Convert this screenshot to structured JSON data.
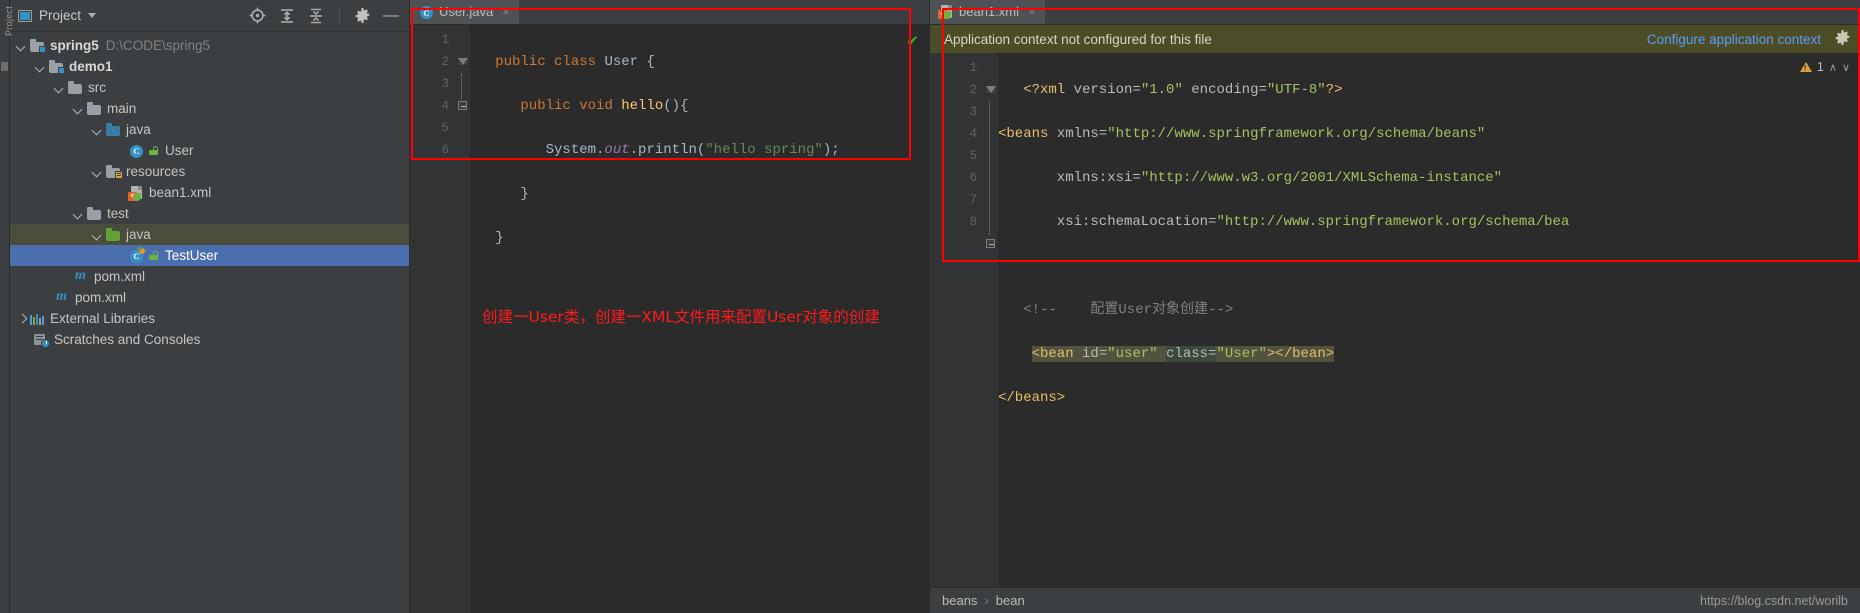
{
  "window": {
    "tool_window_label": "Project"
  },
  "sidebar": {
    "title": "Project",
    "tools": [
      {
        "name": "locate-icon",
        "tooltip": "Select Opened File"
      },
      {
        "name": "expand-all-icon",
        "tooltip": "Expand All"
      },
      {
        "name": "collapse-all-icon",
        "tooltip": "Collapse All"
      },
      {
        "name": "gear-icon",
        "tooltip": "Settings"
      },
      {
        "name": "minimize-icon",
        "tooltip": "Hide"
      }
    ],
    "tree": [
      {
        "label": "spring5",
        "path": "D:\\CODE\\spring5",
        "indent": 0,
        "arrow": "open",
        "icon": "module-folder",
        "bold": true,
        "state": "none"
      },
      {
        "label": "demo1",
        "path": "",
        "indent": 1,
        "arrow": "open",
        "icon": "module-folder",
        "bold": true,
        "state": "none"
      },
      {
        "label": "src",
        "path": "",
        "indent": 2,
        "arrow": "open",
        "icon": "folder-gray",
        "bold": false,
        "state": "none"
      },
      {
        "label": "main",
        "path": "",
        "indent": 3,
        "arrow": "open",
        "icon": "folder-gray",
        "bold": false,
        "state": "none"
      },
      {
        "label": "java",
        "path": "",
        "indent": 4,
        "arrow": "open",
        "icon": "folder-blue",
        "bold": false,
        "state": "none"
      },
      {
        "label": "User",
        "path": "",
        "indent": 5,
        "arrow": "none",
        "icon": "java-class",
        "bold": false,
        "state": "none"
      },
      {
        "label": "resources",
        "path": "",
        "indent": 4,
        "arrow": "open",
        "icon": "folder-resources",
        "bold": false,
        "state": "none"
      },
      {
        "label": "bean1.xml",
        "path": "",
        "indent": 5,
        "arrow": "none",
        "icon": "spring-xml",
        "bold": false,
        "state": "none"
      },
      {
        "label": "test",
        "path": "",
        "indent": 3,
        "arrow": "open",
        "icon": "folder-gray",
        "bold": false,
        "state": "none"
      },
      {
        "label": "java",
        "path": "",
        "indent": 4,
        "arrow": "open",
        "icon": "folder-green",
        "bold": false,
        "state": "hover"
      },
      {
        "label": "TestUser",
        "path": "",
        "indent": 5,
        "arrow": "none",
        "icon": "test-class",
        "bold": false,
        "state": "selected"
      },
      {
        "label": "pom.xml",
        "path": "",
        "indent": 3,
        "arrow": "none",
        "icon": "maven",
        "bold": false,
        "state": "none"
      },
      {
        "label": "pom.xml",
        "path": "",
        "indent": 2,
        "arrow": "none",
        "icon": "maven",
        "bold": false,
        "state": "none"
      },
      {
        "label": "External Libraries",
        "path": "",
        "indent": 1,
        "arrow": "closed",
        "icon": "libraries",
        "bold": false,
        "state": "none"
      },
      {
        "label": "Scratches and Consoles",
        "path": "",
        "indent": 1,
        "arrow": "none",
        "icon": "scratches",
        "bold": false,
        "state": "none"
      }
    ]
  },
  "java_editor": {
    "tab": {
      "label": "User.java",
      "icon": "java-class-icon",
      "close": "×"
    },
    "inspection_status": "✔",
    "line_numbers": [
      "1",
      "2",
      "3",
      "4",
      "5",
      "6"
    ],
    "code": {
      "l1_kw_public": "public",
      "l1_kw_class": "class",
      "l1_name": "User",
      "l1_brace": "{",
      "l2_kw_public": "public",
      "l2_kw_void": "void",
      "l2_name": "hello",
      "l2_rest": "(){",
      "l3_system": "System.",
      "l3_out": "out",
      "l3_println": ".println(",
      "l3_string": "\"hello spring\"",
      "l3_end": ");",
      "l4_brace": "}",
      "l5_brace": "}"
    }
  },
  "xml_editor": {
    "tab": {
      "label": "bean1.xml",
      "icon": "spring-xml-icon",
      "close": "×"
    },
    "banner": {
      "message": "Application context not configured for this file",
      "action": "Configure application context",
      "gear": "gear-icon"
    },
    "warnings": {
      "count": "1",
      "icon": "warning-triangle-icon",
      "up": "∧",
      "down": "∨"
    },
    "line_numbers": [
      "1",
      "2",
      "3",
      "4",
      "5",
      "6",
      "7",
      "8"
    ],
    "code": {
      "l1": "<?xml version=\"1.0\" encoding=\"UTF-8\"?>",
      "l1_tag": "<?xml",
      "l1_att_version": "version=",
      "l1_val_version": "\"1.0\"",
      "l1_att_encoding": "encoding=",
      "l1_val_encoding": "\"UTF-8\"",
      "l1_close": "?>",
      "l2_tag": "<beans",
      "l2_att": "xmlns=",
      "l2_val": "\"http://www.springframework.org/schema/beans\"",
      "l3_att": "xmlns:xsi=",
      "l3_val": "\"http://www.w3.org/2001/XMLSchema-instance\"",
      "l4_att": "xsi:schemaLocation=",
      "l4_val": "\"http://www.springframework.org/schema/bea",
      "l6_comment_open": "<!--",
      "l6_comment_text": "配置User对象创建-->",
      "l7_tag": "<bean",
      "l7_att_id": "id=",
      "l7_val_id": "\"user\"",
      "l7_att_class": "class=",
      "l7_val_class": "\"User\"",
      "l7_close": "></bean>",
      "l8_tag": "</beans>"
    }
  },
  "status_bar": {
    "breadcrumb": [
      "beans",
      "bean"
    ],
    "separator": "›",
    "watermark": "https://blog.csdn.net/worilb"
  },
  "annotations": {
    "note_text": "创建一User类，创建一XML文件用来配置User对象的创建",
    "box_color": "#ff0000"
  }
}
